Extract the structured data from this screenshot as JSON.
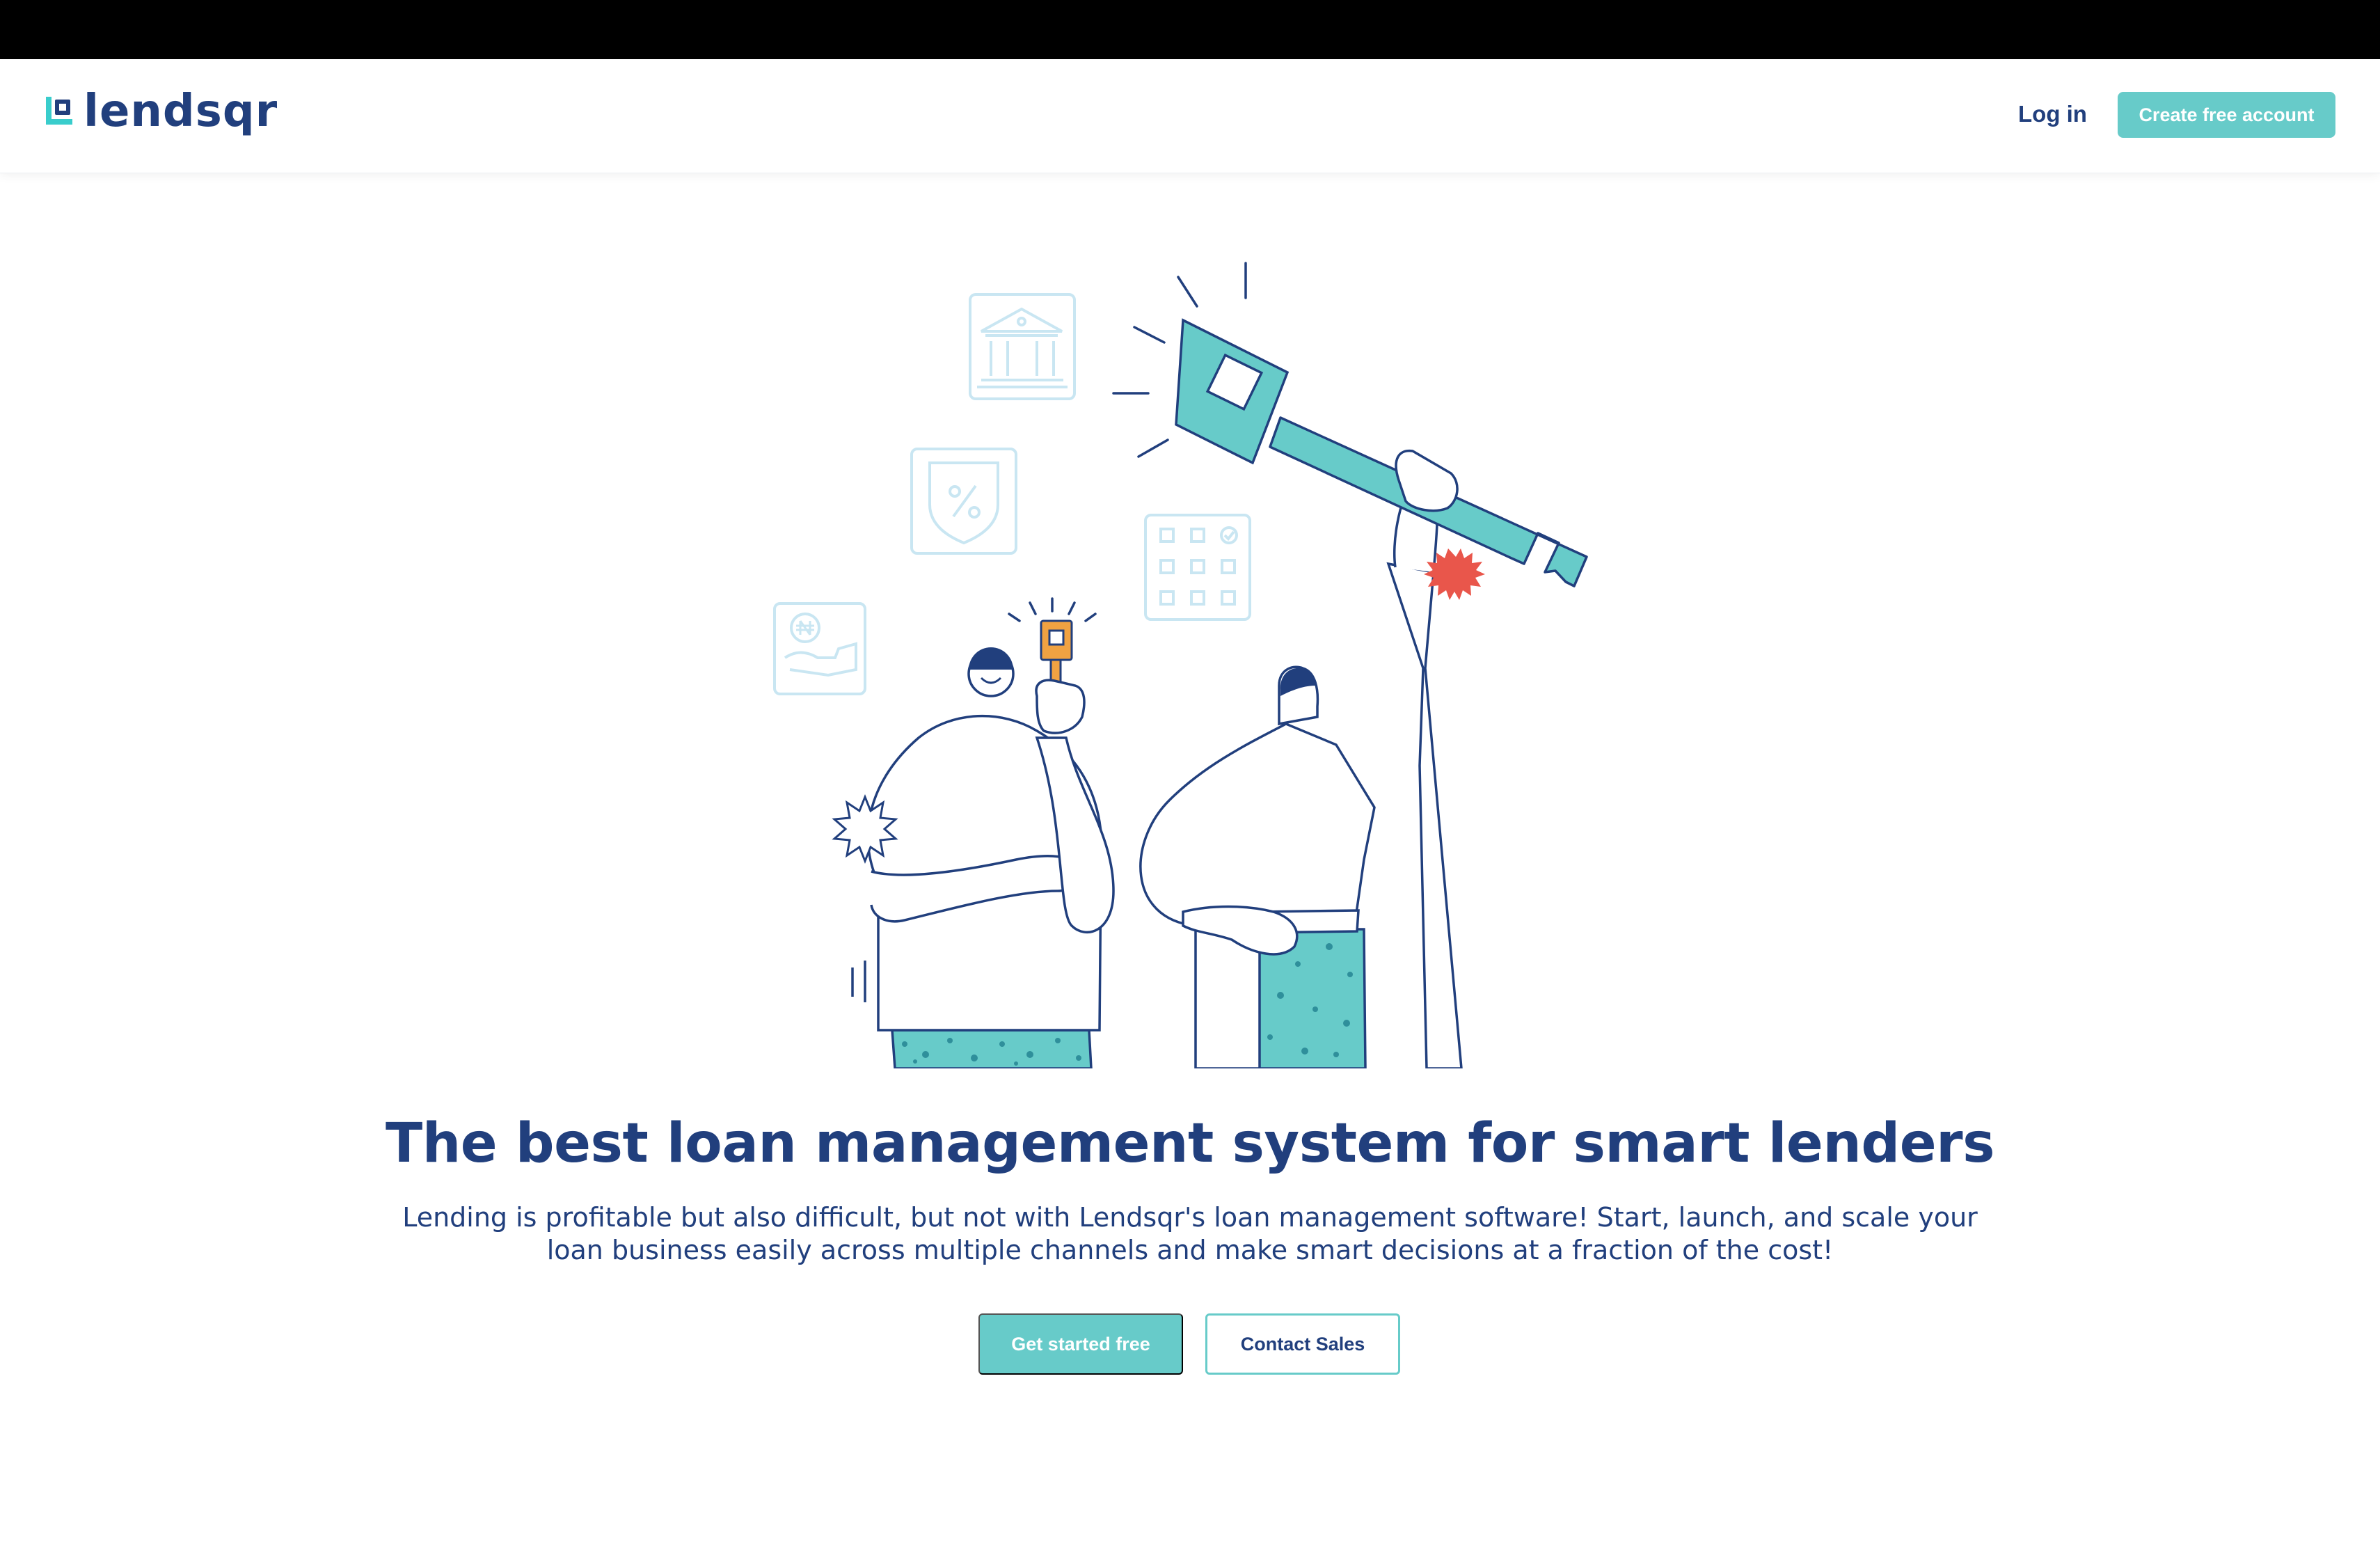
{
  "brand": {
    "name": "lendsqr",
    "colors": {
      "navy": "#213f7d",
      "teal": "#67cbc9",
      "orange": "#f0a242",
      "red": "#e9564b",
      "light_blue": "#c9e6f2"
    }
  },
  "nav": {
    "login_label": "Log in",
    "create_account_label": "Create free account"
  },
  "hero": {
    "illustration_icons": [
      "bank-icon",
      "shield-percent-icon",
      "calendar-grid-icon",
      "naira-hand-icon",
      "key-icon"
    ],
    "headline": "The best loan management system for smart lenders",
    "subtext_line1": "Lending is profitable but also difficult, but not with Lendsqr's loan management software! Start, launch, and scale your",
    "subtext_line2": "loan business easily across multiple channels and make smart decisions at a fraction of the cost!",
    "primary_cta": "Get started free",
    "secondary_cta": "Contact Sales"
  }
}
